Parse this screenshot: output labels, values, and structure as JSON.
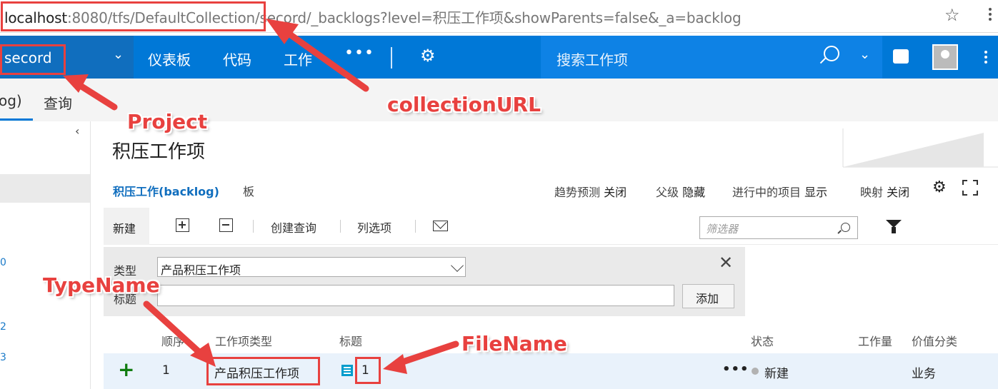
{
  "address_bar": {
    "host": "localhost",
    "rest": ":8080/tfs/DefaultCollection/secord/_backlogs?level=积压工作项&showParents=false&_a=backlog"
  },
  "topnav": {
    "project": "secord",
    "items": [
      "仪表板",
      "代码",
      "工作"
    ],
    "more": "•••",
    "search_placeholder": "搜索工作项"
  },
  "subtabs": {
    "backlog_fragment": "og)",
    "query": "查询"
  },
  "leftpane": {
    "collapse": "‹",
    "numbers": [
      "0",
      "2",
      "3"
    ]
  },
  "page": {
    "title": "积压工作项",
    "tabs": {
      "backlog": "积压工作(backlog)",
      "board": "板"
    },
    "options": [
      {
        "label": "趋势预测",
        "value": "关闭"
      },
      {
        "label": "父级",
        "value": "隐藏"
      },
      {
        "label": "进行中的项目",
        "value": "显示"
      },
      {
        "label": "映射",
        "value": "关闭"
      }
    ]
  },
  "toolbar": {
    "new": "新建",
    "create_query": "创建查询",
    "column_options": "列选项",
    "filter_placeholder": "筛选器"
  },
  "add_panel": {
    "type_label": "类型",
    "type_value": "产品积压工作项",
    "title_label": "标题",
    "add_button": "添加"
  },
  "grid": {
    "headers": {
      "order": "顺序",
      "type": "工作项类型",
      "title": "标题",
      "state": "状态",
      "effort": "工作量",
      "value_area": "价值分类"
    },
    "rows": [
      {
        "order": "1",
        "type": "产品积压工作项",
        "title": "1",
        "state": "新建",
        "value_area": "业务"
      }
    ]
  },
  "annotations": {
    "collection_url": "collectionURL",
    "project": "Project",
    "type_name": "TypeName",
    "file_name": "FileName",
    "color": "#e8413f"
  }
}
